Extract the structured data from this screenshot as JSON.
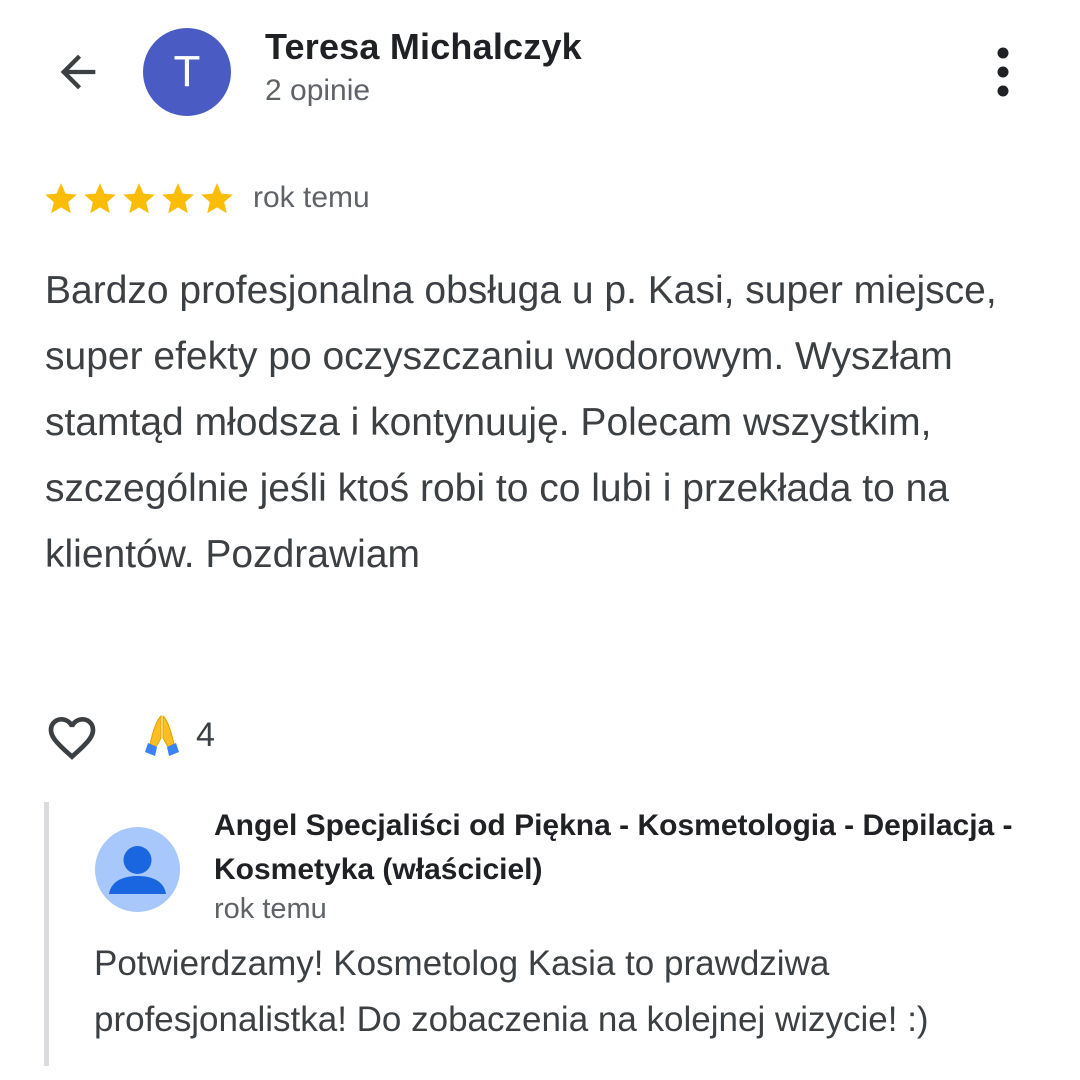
{
  "header": {
    "back_icon": "arrow-back-icon",
    "avatar_letter": "T",
    "avatar_color": "#4a5cc4",
    "reviewer_name": "Teresa Michalczyk",
    "reviewer_reviews": "2 opinie",
    "more_icon": "more-vert-icon"
  },
  "review": {
    "rating": 5,
    "max_rating": 5,
    "star_color": "#fbbc04",
    "time": "rok temu",
    "text": "Bardzo profesjonalna obsługa u p. Kasi, super miejsce, super efekty po oczyszczaniu wodorowym. Wyszłam stamtąd młodsza i kontynuuję. Polecam wszystkim, szczególnie jeśli ktoś robi to co lubi i przekłada to na klientów. Pozdrawiam"
  },
  "actions": {
    "like_icon": "heart-outline-icon",
    "reaction_emoji": "🙏",
    "reaction_count": "4"
  },
  "owner_reply": {
    "avatar_icon": "person-icon",
    "name": "Angel Specjaliści od Piękna - Kosmetologia - Depilacja - Kosmetyka (właściciel)",
    "time": "rok temu",
    "text": "Potwierdzamy! Kosmetolog Kasia to prawdziwa profesjonalistka! Do zobaczenia na kolejnej wizycie! :)"
  }
}
